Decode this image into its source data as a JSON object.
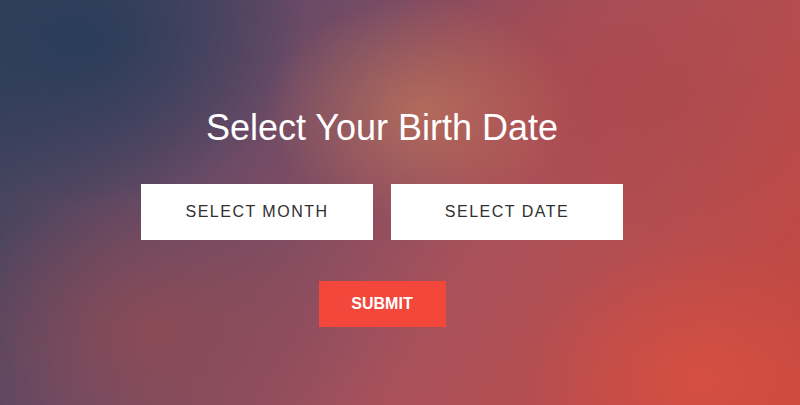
{
  "page": {
    "title": "Select Your Birth Date"
  },
  "selects": [
    {
      "label": "SELECT MONTH"
    },
    {
      "label": "SELECT DATE"
    }
  ],
  "buttons": [
    "SUBMIT"
  ]
}
